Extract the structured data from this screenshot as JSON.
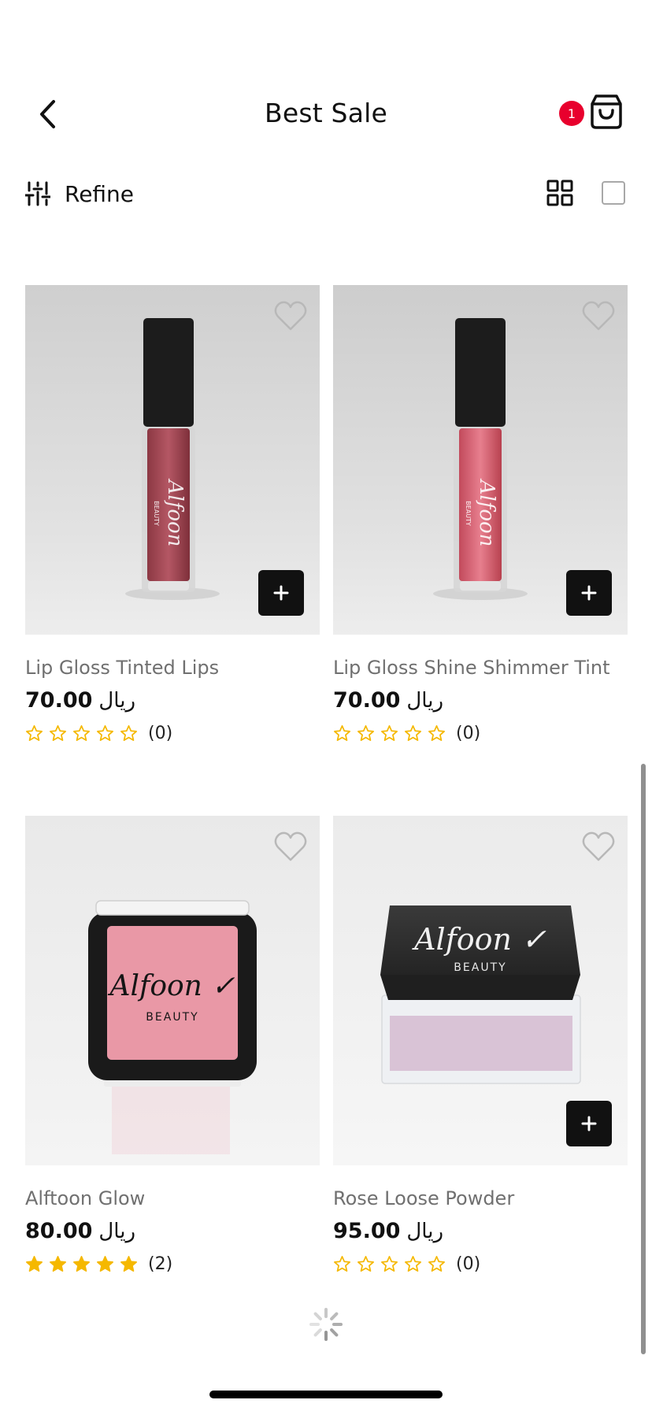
{
  "header": {
    "title": "Best Sale",
    "cart_count": "1",
    "icons": {
      "back": "chevron-left-icon",
      "cart": "shopping-bag-icon"
    }
  },
  "toolbar": {
    "refine_label": "Refine",
    "icons": {
      "refine": "sliders-icon",
      "grid_view": "grid-view-icon",
      "list_view": "single-view-icon"
    }
  },
  "products": [
    {
      "name": "Lip Gloss Tinted Lips",
      "price": "70.00",
      "currency": "ريال",
      "rating": 0,
      "reviews": "(0)",
      "wishlist_icon": "heart-icon",
      "add_icon": "plus-icon",
      "has_add_button": true
    },
    {
      "name": "Lip Gloss Shine Shimmer Tint",
      "price": "70.00",
      "currency": "ريال",
      "rating": 0,
      "reviews": "(0)",
      "wishlist_icon": "heart-icon",
      "add_icon": "plus-icon",
      "has_add_button": true
    },
    {
      "name": "Alftoon Glow",
      "price": "80.00",
      "currency": "ريال",
      "rating": 5,
      "reviews": "(2)",
      "wishlist_icon": "heart-icon",
      "has_add_button": false
    },
    {
      "name": "Rose Loose Powder",
      "price": "95.00",
      "currency": "ريال",
      "rating": 0,
      "reviews": "(0)",
      "wishlist_icon": "heart-icon",
      "add_icon": "plus-icon",
      "has_add_button": true
    }
  ],
  "colors": {
    "badge": "#e8002d",
    "star": "#f5b800",
    "add_button": "#111111"
  }
}
